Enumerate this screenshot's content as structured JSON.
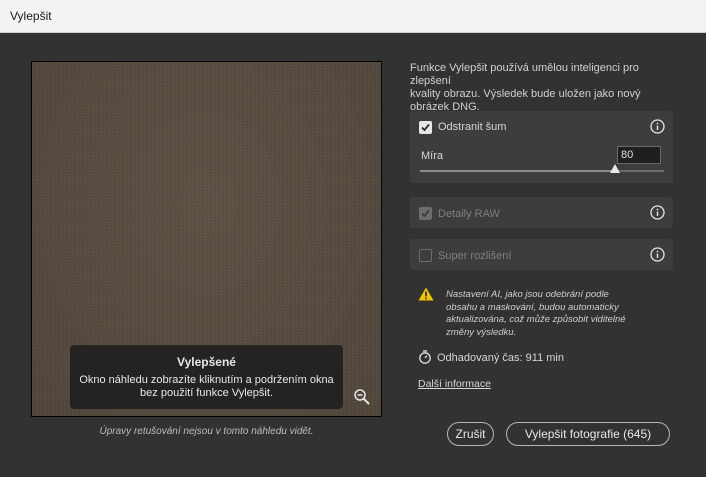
{
  "window": {
    "title": "Vylepšit"
  },
  "preview": {
    "overlay_title": "Vylepšené",
    "overlay_text_line1": "Okno náhledu zobrazíte kliknutím a podržením okna",
    "overlay_text_line2": "bez použití funkce Vylepšit.",
    "zoom_icon": "zoom-out-icon",
    "note": "Úpravy retušování nejsou v tomto náhledu vidět."
  },
  "description": {
    "line1": "Funkce Vylepšit používá umělou inteligenci pro zlepšení",
    "line2": "kvality obrazu. Výsledek bude uložen jako nový",
    "line3": "obrázek DNG."
  },
  "denoise": {
    "label": "Odstranit šum",
    "checked": true,
    "amount_label": "Míra",
    "amount_value": "80",
    "amount_fraction": 0.8,
    "info_icon": "info-icon"
  },
  "raw_details": {
    "label": "Detaily RAW",
    "checked": true,
    "disabled": true,
    "info_icon": "info-icon"
  },
  "super_resolution": {
    "label": "Super rozlišení",
    "checked": false,
    "disabled": true,
    "info_icon": "info-icon"
  },
  "warning": {
    "icon": "warning-icon",
    "line1": "Nastavení AI, jako jsou odebrání podle",
    "line2": "obsahu a maskování, budou automaticky",
    "line3": "aktualizována, což může způsobit viditelné",
    "line4": "změny výsledku."
  },
  "estimate": {
    "icon": "timer-icon",
    "text": "Odhadovaný čas: 911 min"
  },
  "more_info": "Další informace",
  "buttons": {
    "cancel": "Zrušit",
    "enhance": "Vylepšit fotografie (645)"
  },
  "colors": {
    "background": "#323232",
    "panel": "#3d3d3d",
    "warning": "#f0c400"
  }
}
